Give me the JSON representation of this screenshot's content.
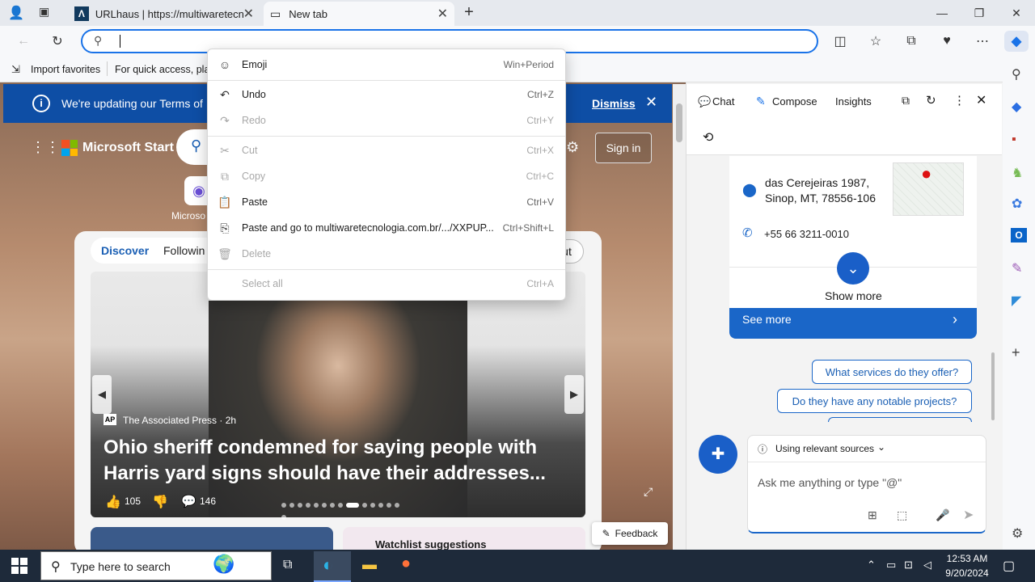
{
  "tabs": [
    {
      "label": "URLhaus | https://multiwaretecnol"
    },
    {
      "label": "New tab"
    }
  ],
  "favorites": {
    "import": "Import favorites",
    "hint": "For quick access, plac"
  },
  "banner": {
    "text": "We're updating our Terms of",
    "dismiss": "Dismiss"
  },
  "start": {
    "brand": "Microsoft Start",
    "sign_in": "Sign in",
    "copilot_label": "Microso",
    "tab_discover": "Discover",
    "tab_following": "Followin",
    "layout_btn": "ut"
  },
  "story": {
    "source_logo": "AP",
    "source": "The Associated Press · 2h",
    "headline": "Ohio sheriff condemned for saying people with Harris yard signs should have their addresses...",
    "likes": "105",
    "comments": "146"
  },
  "feedback": "Feedback",
  "watchlist": "Watchlist suggestions",
  "context_menu": [
    {
      "label": "Emoji",
      "shortcut": "Win+Period",
      "icon": "emoji-icon",
      "disabled": false
    },
    {
      "label": "Undo",
      "shortcut": "Ctrl+Z",
      "icon": "undo-icon",
      "disabled": false
    },
    {
      "label": "Redo",
      "shortcut": "Ctrl+Y",
      "icon": "redo-icon",
      "disabled": true
    },
    {
      "label": "Cut",
      "shortcut": "Ctrl+X",
      "icon": "cut-icon",
      "disabled": true
    },
    {
      "label": "Copy",
      "shortcut": "Ctrl+C",
      "icon": "copy-icon",
      "disabled": true
    },
    {
      "label": "Paste",
      "shortcut": "Ctrl+V",
      "icon": "paste-icon",
      "disabled": false
    },
    {
      "label": "Paste and go to multiwaretecnologia.com.br/.../XXPUP...",
      "shortcut": "Ctrl+Shift+L",
      "icon": "paste-go-icon",
      "disabled": false
    },
    {
      "label": "Delete",
      "shortcut": "",
      "icon": "delete-icon",
      "disabled": true
    },
    {
      "label": "Select all",
      "shortcut": "Ctrl+A",
      "icon": "",
      "disabled": true
    }
  ],
  "copilot": {
    "tab_chat": "Chat",
    "tab_compose": "Compose",
    "tab_insights": "Insights",
    "address_line1": "das Cerejeiras 1987,",
    "address_line2": "Sinop, MT, 78556-106",
    "phone": "+55 66 3211-0010",
    "show_more": "Show more",
    "see_more": "See more",
    "suggestion1": "What services do they offer?",
    "suggestion2": "Do they have any notable projects?",
    "sources": "Using relevant sources",
    "input_placeholder": "Ask me anything or type \"@\""
  },
  "taskbar": {
    "search": "Type here to search",
    "time": "12:53 AM",
    "date": "9/20/2024"
  },
  "colors": {
    "accent": "#0e4ea5",
    "copilot_blue": "#1a66c8",
    "taskbar": "#1e2a3a"
  }
}
